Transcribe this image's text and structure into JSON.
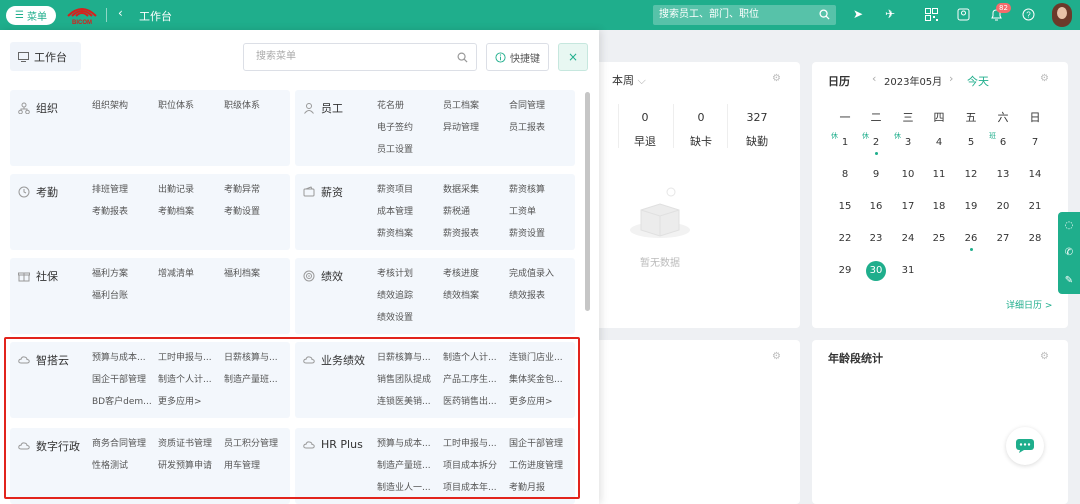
{
  "topbar": {
    "menu_label": "菜单",
    "logo_text": "BICOM",
    "title": "工作台",
    "search_placeholder": "搜索员工、部门、职位",
    "notification_count": "82"
  },
  "attendance": {
    "period": "本周",
    "stats": [
      {
        "value": "0",
        "label": "早退"
      },
      {
        "value": "0",
        "label": "缺卡"
      },
      {
        "value": "327",
        "label": "缺勤"
      }
    ],
    "empty_text": "暂无数据"
  },
  "calendar": {
    "title": "日历",
    "month": "2023年05月",
    "today_label": "今天",
    "weekdays": [
      "一",
      "二",
      "三",
      "四",
      "五",
      "六",
      "日"
    ],
    "rows": [
      [
        "1",
        "2",
        "3",
        "4",
        "5",
        "6",
        "7"
      ],
      [
        "8",
        "9",
        "10",
        "11",
        "12",
        "13",
        "14"
      ],
      [
        "15",
        "16",
        "17",
        "18",
        "19",
        "20",
        "21"
      ],
      [
        "22",
        "23",
        "24",
        "25",
        "26",
        "27",
        "28"
      ],
      [
        "29",
        "30",
        "31"
      ]
    ],
    "holiday_tag": "休",
    "work_tag": "班",
    "detail_link": "详细日历 >"
  },
  "age_panel": {
    "title": "年龄段统计"
  },
  "menu": {
    "workbench_tab": "工作台",
    "search_placeholder": "搜索菜单",
    "hotkey_label": "快捷键",
    "categories": [
      {
        "name": "组织",
        "items": [
          "组织架构",
          "职位体系",
          "职级体系"
        ]
      },
      {
        "name": "员工",
        "items": [
          "花名册",
          "员工档案",
          "合同管理",
          "电子签约",
          "异动管理",
          "员工报表",
          "员工设置"
        ]
      },
      {
        "name": "考勤",
        "items": [
          "排班管理",
          "出勤记录",
          "考勤异常",
          "考勤报表",
          "考勤档案",
          "考勤设置"
        ]
      },
      {
        "name": "薪资",
        "items": [
          "薪资项目",
          "数据采集",
          "薪资核算",
          "成本管理",
          "薪税通",
          "工资单",
          "薪资档案",
          "薪资报表",
          "薪资设置"
        ]
      },
      {
        "name": "社保",
        "items": [
          "福利方案",
          "增减清单",
          "福利档案",
          "福利台账"
        ]
      },
      {
        "name": "绩效",
        "items": [
          "考核计划",
          "考核进度",
          "完成值录入",
          "绩效追踪",
          "绩效档案",
          "绩效报表",
          "绩效设置"
        ]
      },
      {
        "name": "智搭云",
        "items": [
          "预算与成本...",
          "工时申报与...",
          "日薪核算与...",
          "国企干部管理",
          "制造个人计...",
          "制造产量班...",
          "BD客户dem...",
          "更多应用>"
        ]
      },
      {
        "name": "业务绩效",
        "items": [
          "日薪核算与...",
          "制造个人计...",
          "连锁门店业...",
          "销售团队提成",
          "产品工序生...",
          "集体奖金包...",
          "连锁医美销...",
          "医药销售出...",
          "更多应用>"
        ]
      },
      {
        "name": "数字行政",
        "items": [
          "商务合同管理",
          "资质证书管理",
          "员工积分管理",
          "性格测试",
          "研发预算申请",
          "用车管理"
        ]
      },
      {
        "name": "HR Plus",
        "items": [
          "预算与成本...",
          "工时申报与...",
          "国企干部管理",
          "制造产量班...",
          "项目成本拆分",
          "工伤进度管理",
          "制造业人一...",
          "项目成本年...",
          "考勤月报"
        ]
      }
    ]
  }
}
